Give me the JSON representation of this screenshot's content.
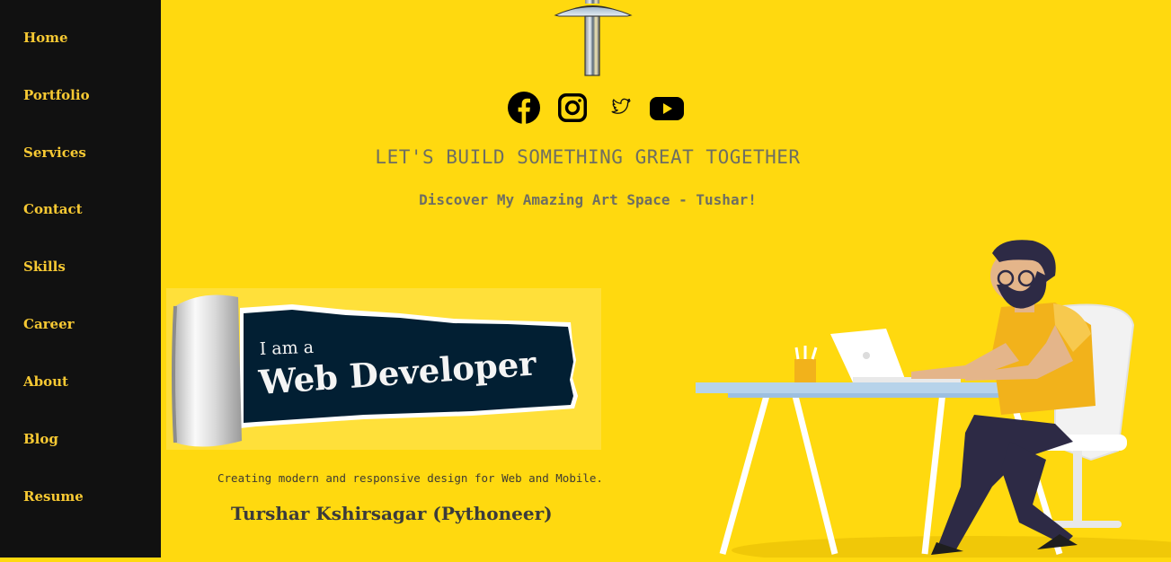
{
  "nav": {
    "items": [
      {
        "label": "Home"
      },
      {
        "label": "Portfolio"
      },
      {
        "label": "Services"
      },
      {
        "label": "Contact"
      },
      {
        "label": "Skills"
      },
      {
        "label": "Career"
      },
      {
        "label": "About"
      },
      {
        "label": "Blog"
      },
      {
        "label": "Resume"
      }
    ]
  },
  "hero": {
    "logo_icon": "t-letter-logo",
    "socials": [
      {
        "icon": "facebook-icon"
      },
      {
        "icon": "instagram-icon"
      },
      {
        "icon": "twitter-icon"
      },
      {
        "icon": "youtube-icon"
      }
    ],
    "headline": "LET'S BUILD SOMETHING GREAT TOGETHER",
    "subline": "Discover My Amazing Art Space - Tushar!"
  },
  "banner": {
    "line1": "I am a",
    "line2": "Web Developer"
  },
  "tagline": "Creating modern and responsive design for Web and Mobile.",
  "author": "Turshar Kshirsagar (Pythoneer)",
  "colors": {
    "background": "#ffd90f",
    "sidebar": "#111111",
    "nav_text": "#f7c933",
    "heading_text": "#6e6e62",
    "banner_dark": "#021f33"
  }
}
